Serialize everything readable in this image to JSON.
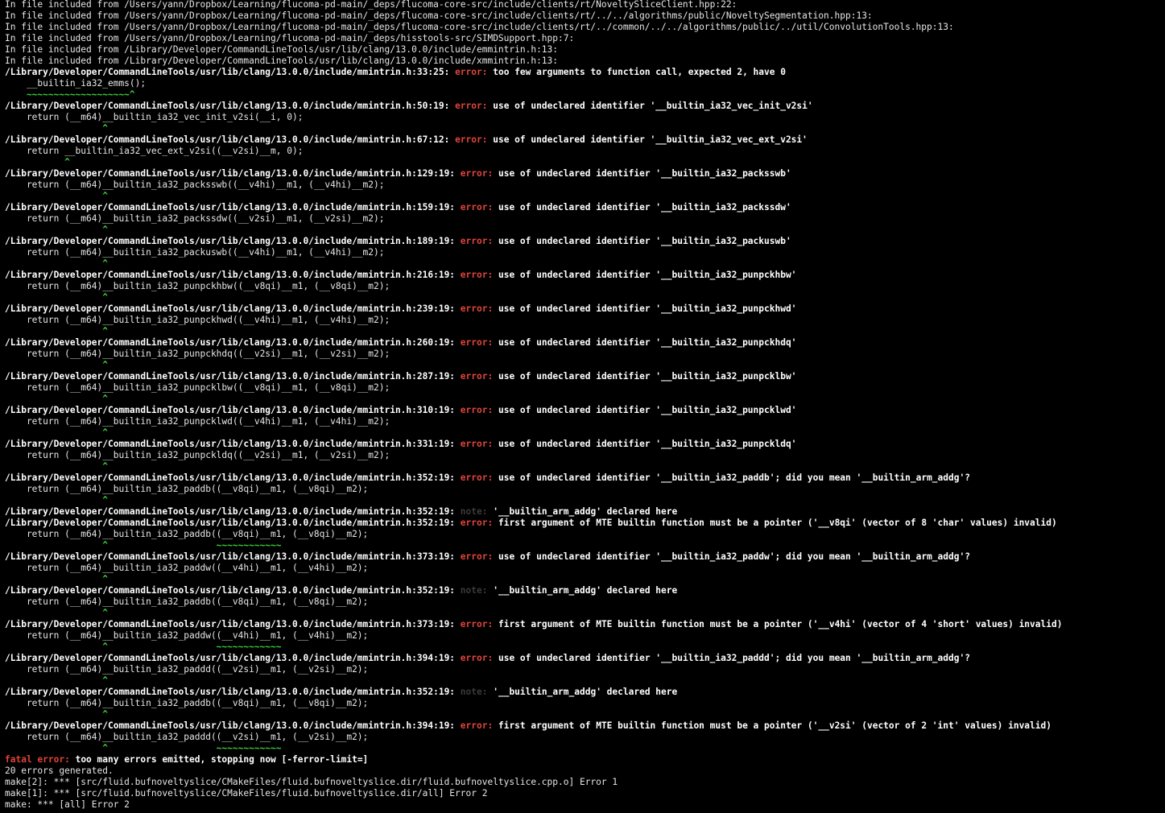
{
  "colors": {
    "background": "#000000",
    "text": "#e6e6e6",
    "bold": "#ffffff",
    "error": "#e0443a",
    "note": "#3a3a3a",
    "caret": "#3bd43a"
  },
  "lines": [
    {
      "kind": "plain",
      "text": "In file included from /Users/yann/Dropbox/Learning/flucoma-pd-main/_deps/flucoma-core-src/include/clients/rt/NoveltySliceClient.hpp:22:"
    },
    {
      "kind": "plain",
      "text": "In file included from /Users/yann/Dropbox/Learning/flucoma-pd-main/_deps/flucoma-core-src/include/clients/rt/../../algorithms/public/NoveltySegmentation.hpp:13:"
    },
    {
      "kind": "plain",
      "text": "In file included from /Users/yann/Dropbox/Learning/flucoma-pd-main/_deps/flucoma-core-src/include/clients/rt/../common/../../algorithms/public/../util/ConvolutionTools.hpp:13:"
    },
    {
      "kind": "plain",
      "text": "In file included from /Users/yann/Dropbox/Learning/flucoma-pd-main/_deps/hisstools-src/SIMDSupport.hpp:7:"
    },
    {
      "kind": "plain",
      "text": "In file included from /Library/Developer/CommandLineTools/usr/lib/clang/13.0.0/include/emmintrin.h:13:"
    },
    {
      "kind": "plain",
      "text": "In file included from /Library/Developer/CommandLineTools/usr/lib/clang/13.0.0/include/xmmintrin.h:13:"
    },
    {
      "kind": "diag",
      "loc": "/Library/Developer/CommandLineTools/usr/lib/clang/13.0.0/include/mmintrin.h:33:25:",
      "label": "error:",
      "msg": "too few arguments to function call, expected 2, have 0"
    },
    {
      "kind": "plain",
      "text": "    __builtin_ia32_emms();"
    },
    {
      "kind": "caret",
      "text": "    ~~~~~~~~~~~~~~~~~~~^"
    },
    {
      "kind": "diag",
      "loc": "/Library/Developer/CommandLineTools/usr/lib/clang/13.0.0/include/mmintrin.h:50:19:",
      "label": "error:",
      "msg": "use of undeclared identifier '__builtin_ia32_vec_init_v2si'"
    },
    {
      "kind": "plain",
      "text": "    return (__m64)__builtin_ia32_vec_init_v2si(__i, 0);"
    },
    {
      "kind": "caret",
      "text": "                  ^"
    },
    {
      "kind": "diag",
      "loc": "/Library/Developer/CommandLineTools/usr/lib/clang/13.0.0/include/mmintrin.h:67:12:",
      "label": "error:",
      "msg": "use of undeclared identifier '__builtin_ia32_vec_ext_v2si'"
    },
    {
      "kind": "plain",
      "text": "    return __builtin_ia32_vec_ext_v2si((__v2si)__m, 0);"
    },
    {
      "kind": "caret",
      "text": "           ^"
    },
    {
      "kind": "diag",
      "loc": "/Library/Developer/CommandLineTools/usr/lib/clang/13.0.0/include/mmintrin.h:129:19:",
      "label": "error:",
      "msg": "use of undeclared identifier '__builtin_ia32_packsswb'"
    },
    {
      "kind": "plain",
      "text": "    return (__m64)__builtin_ia32_packsswb((__v4hi)__m1, (__v4hi)__m2);"
    },
    {
      "kind": "caret",
      "text": "                  ^"
    },
    {
      "kind": "diag",
      "loc": "/Library/Developer/CommandLineTools/usr/lib/clang/13.0.0/include/mmintrin.h:159:19:",
      "label": "error:",
      "msg": "use of undeclared identifier '__builtin_ia32_packssdw'"
    },
    {
      "kind": "plain",
      "text": "    return (__m64)__builtin_ia32_packssdw((__v2si)__m1, (__v2si)__m2);"
    },
    {
      "kind": "caret",
      "text": "                  ^"
    },
    {
      "kind": "diag",
      "loc": "/Library/Developer/CommandLineTools/usr/lib/clang/13.0.0/include/mmintrin.h:189:19:",
      "label": "error:",
      "msg": "use of undeclared identifier '__builtin_ia32_packuswb'"
    },
    {
      "kind": "plain",
      "text": "    return (__m64)__builtin_ia32_packuswb((__v4hi)__m1, (__v4hi)__m2);"
    },
    {
      "kind": "caret",
      "text": "                  ^"
    },
    {
      "kind": "diag",
      "loc": "/Library/Developer/CommandLineTools/usr/lib/clang/13.0.0/include/mmintrin.h:216:19:",
      "label": "error:",
      "msg": "use of undeclared identifier '__builtin_ia32_punpckhbw'"
    },
    {
      "kind": "plain",
      "text": "    return (__m64)__builtin_ia32_punpckhbw((__v8qi)__m1, (__v8qi)__m2);"
    },
    {
      "kind": "caret",
      "text": "                  ^"
    },
    {
      "kind": "diag",
      "loc": "/Library/Developer/CommandLineTools/usr/lib/clang/13.0.0/include/mmintrin.h:239:19:",
      "label": "error:",
      "msg": "use of undeclared identifier '__builtin_ia32_punpckhwd'"
    },
    {
      "kind": "plain",
      "text": "    return (__m64)__builtin_ia32_punpckhwd((__v4hi)__m1, (__v4hi)__m2);"
    },
    {
      "kind": "caret",
      "text": "                  ^"
    },
    {
      "kind": "diag",
      "loc": "/Library/Developer/CommandLineTools/usr/lib/clang/13.0.0/include/mmintrin.h:260:19:",
      "label": "error:",
      "msg": "use of undeclared identifier '__builtin_ia32_punpckhdq'"
    },
    {
      "kind": "plain",
      "text": "    return (__m64)__builtin_ia32_punpckhdq((__v2si)__m1, (__v2si)__m2);"
    },
    {
      "kind": "caret",
      "text": "                  ^"
    },
    {
      "kind": "diag",
      "loc": "/Library/Developer/CommandLineTools/usr/lib/clang/13.0.0/include/mmintrin.h:287:19:",
      "label": "error:",
      "msg": "use of undeclared identifier '__builtin_ia32_punpcklbw'"
    },
    {
      "kind": "plain",
      "text": "    return (__m64)__builtin_ia32_punpcklbw((__v8qi)__m1, (__v8qi)__m2);"
    },
    {
      "kind": "caret",
      "text": "                  ^"
    },
    {
      "kind": "diag",
      "loc": "/Library/Developer/CommandLineTools/usr/lib/clang/13.0.0/include/mmintrin.h:310:19:",
      "label": "error:",
      "msg": "use of undeclared identifier '__builtin_ia32_punpcklwd'"
    },
    {
      "kind": "plain",
      "text": "    return (__m64)__builtin_ia32_punpcklwd((__v4hi)__m1, (__v4hi)__m2);"
    },
    {
      "kind": "caret",
      "text": "                  ^"
    },
    {
      "kind": "diag",
      "loc": "/Library/Developer/CommandLineTools/usr/lib/clang/13.0.0/include/mmintrin.h:331:19:",
      "label": "error:",
      "msg": "use of undeclared identifier '__builtin_ia32_punpckldq'"
    },
    {
      "kind": "plain",
      "text": "    return (__m64)__builtin_ia32_punpckldq((__v2si)__m1, (__v2si)__m2);"
    },
    {
      "kind": "caret",
      "text": "                  ^"
    },
    {
      "kind": "diag",
      "loc": "/Library/Developer/CommandLineTools/usr/lib/clang/13.0.0/include/mmintrin.h:352:19:",
      "label": "error:",
      "msg": "use of undeclared identifier '__builtin_ia32_paddb'; did you mean '__builtin_arm_addg'?"
    },
    {
      "kind": "plain",
      "text": "    return (__m64)__builtin_ia32_paddb((__v8qi)__m1, (__v8qi)__m2);"
    },
    {
      "kind": "caret",
      "text": "                  ^"
    },
    {
      "kind": "diag",
      "loc": "/Library/Developer/CommandLineTools/usr/lib/clang/13.0.0/include/mmintrin.h:352:19:",
      "label": "note:",
      "msg": "'__builtin_arm_addg' declared here"
    },
    {
      "kind": "diag",
      "loc": "/Library/Developer/CommandLineTools/usr/lib/clang/13.0.0/include/mmintrin.h:352:19:",
      "label": "error:",
      "msg": "first argument of MTE builtin function must be a pointer ('__v8qi' (vector of 8 'char' values) invalid)"
    },
    {
      "kind": "plain",
      "text": "    return (__m64)__builtin_ia32_paddb((__v8qi)__m1, (__v8qi)__m2);"
    },
    {
      "kind": "caret",
      "text": "                  ^                    ~~~~~~~~~~~~"
    },
    {
      "kind": "diag",
      "loc": "/Library/Developer/CommandLineTools/usr/lib/clang/13.0.0/include/mmintrin.h:373:19:",
      "label": "error:",
      "msg": "use of undeclared identifier '__builtin_ia32_paddw'; did you mean '__builtin_arm_addg'?"
    },
    {
      "kind": "plain",
      "text": "    return (__m64)__builtin_ia32_paddw((__v4hi)__m1, (__v4hi)__m2);"
    },
    {
      "kind": "caret",
      "text": "                  ^"
    },
    {
      "kind": "diag",
      "loc": "/Library/Developer/CommandLineTools/usr/lib/clang/13.0.0/include/mmintrin.h:352:19:",
      "label": "note:",
      "msg": "'__builtin_arm_addg' declared here"
    },
    {
      "kind": "plain",
      "text": "    return (__m64)__builtin_ia32_paddb((__v8qi)__m1, (__v8qi)__m2);"
    },
    {
      "kind": "caret",
      "text": "                  ^"
    },
    {
      "kind": "diag",
      "loc": "/Library/Developer/CommandLineTools/usr/lib/clang/13.0.0/include/mmintrin.h:373:19:",
      "label": "error:",
      "msg": "first argument of MTE builtin function must be a pointer ('__v4hi' (vector of 4 'short' values) invalid)"
    },
    {
      "kind": "plain",
      "text": "    return (__m64)__builtin_ia32_paddw((__v4hi)__m1, (__v4hi)__m2);"
    },
    {
      "kind": "caret",
      "text": "                  ^                    ~~~~~~~~~~~~"
    },
    {
      "kind": "diag",
      "loc": "/Library/Developer/CommandLineTools/usr/lib/clang/13.0.0/include/mmintrin.h:394:19:",
      "label": "error:",
      "msg": "use of undeclared identifier '__builtin_ia32_paddd'; did you mean '__builtin_arm_addg'?"
    },
    {
      "kind": "plain",
      "text": "    return (__m64)__builtin_ia32_paddd((__v2si)__m1, (__v2si)__m2);"
    },
    {
      "kind": "caret",
      "text": "                  ^"
    },
    {
      "kind": "diag",
      "loc": "/Library/Developer/CommandLineTools/usr/lib/clang/13.0.0/include/mmintrin.h:352:19:",
      "label": "note:",
      "msg": "'__builtin_arm_addg' declared here"
    },
    {
      "kind": "plain",
      "text": "    return (__m64)__builtin_ia32_paddb((__v8qi)__m1, (__v8qi)__m2);"
    },
    {
      "kind": "caret",
      "text": "                  ^"
    },
    {
      "kind": "diag",
      "loc": "/Library/Developer/CommandLineTools/usr/lib/clang/13.0.0/include/mmintrin.h:394:19:",
      "label": "error:",
      "msg": "first argument of MTE builtin function must be a pointer ('__v2si' (vector of 2 'int' values) invalid)"
    },
    {
      "kind": "plain",
      "text": "    return (__m64)__builtin_ia32_paddd((__v2si)__m1, (__v2si)__m2);"
    },
    {
      "kind": "caret",
      "text": "                  ^                    ~~~~~~~~~~~~"
    },
    {
      "kind": "fatal",
      "label": "fatal error:",
      "msg": "too many errors emitted, stopping now [-ferror-limit=]"
    },
    {
      "kind": "plain",
      "text": "20 errors generated."
    },
    {
      "kind": "plain",
      "text": "make[2]: *** [src/fluid.bufnoveltyslice/CMakeFiles/fluid.bufnoveltyslice.dir/fluid.bufnoveltyslice.cpp.o] Error 1"
    },
    {
      "kind": "plain",
      "text": "make[1]: *** [src/fluid.bufnoveltyslice/CMakeFiles/fluid.bufnoveltyslice.dir/all] Error 2"
    },
    {
      "kind": "plain",
      "text": "make: *** [all] Error 2"
    }
  ]
}
